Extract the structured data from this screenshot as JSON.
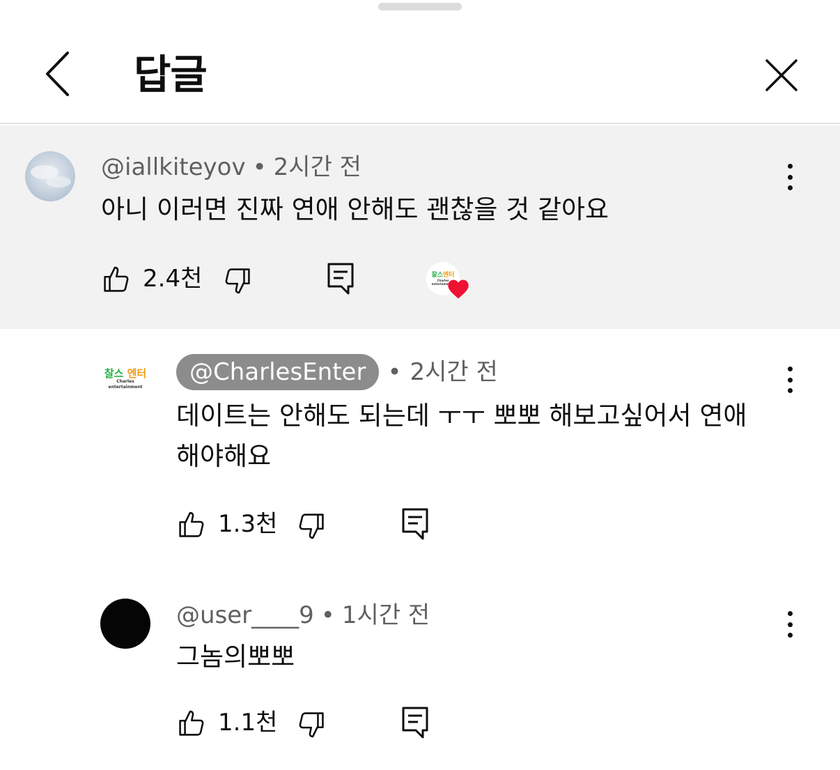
{
  "header": {
    "title": "답글"
  },
  "parent_comment": {
    "handle": "@iallkiteyov",
    "time": "2시간 전",
    "text": "아니 이러면 진짜 연애 안해도 괜찮을 것 같아요",
    "likes": "2.4천",
    "creator_heart": true
  },
  "replies": [
    {
      "handle": "@CharlesEnter",
      "is_creator": true,
      "time": "2시간 전",
      "text_line1": "데이트는 안해도 되는데 ㅜㅜ 뽀뽀 해보고싶어서 연애",
      "text_line2": "해야해요",
      "likes": "1.3천"
    },
    {
      "handle": "@user____9",
      "time": "1시간 전",
      "text": "그놈의뽀뽀",
      "likes": "1.1천"
    }
  ],
  "logo": {
    "word1": "찰스",
    "word2": "엔터",
    "sub": "Charles entertainment"
  },
  "colors": {
    "creator_chip_bg": "#8c8c8c",
    "parent_bg": "#f2f2f2",
    "heart": "#ee1133",
    "logo_green": "#27b14a",
    "logo_orange": "#f29a12"
  },
  "icons": [
    "back-chevron-icon",
    "close-icon",
    "more-vert-icon",
    "thumb-up-icon",
    "thumb-down-icon",
    "reply-comment-icon",
    "heart-icon"
  ]
}
